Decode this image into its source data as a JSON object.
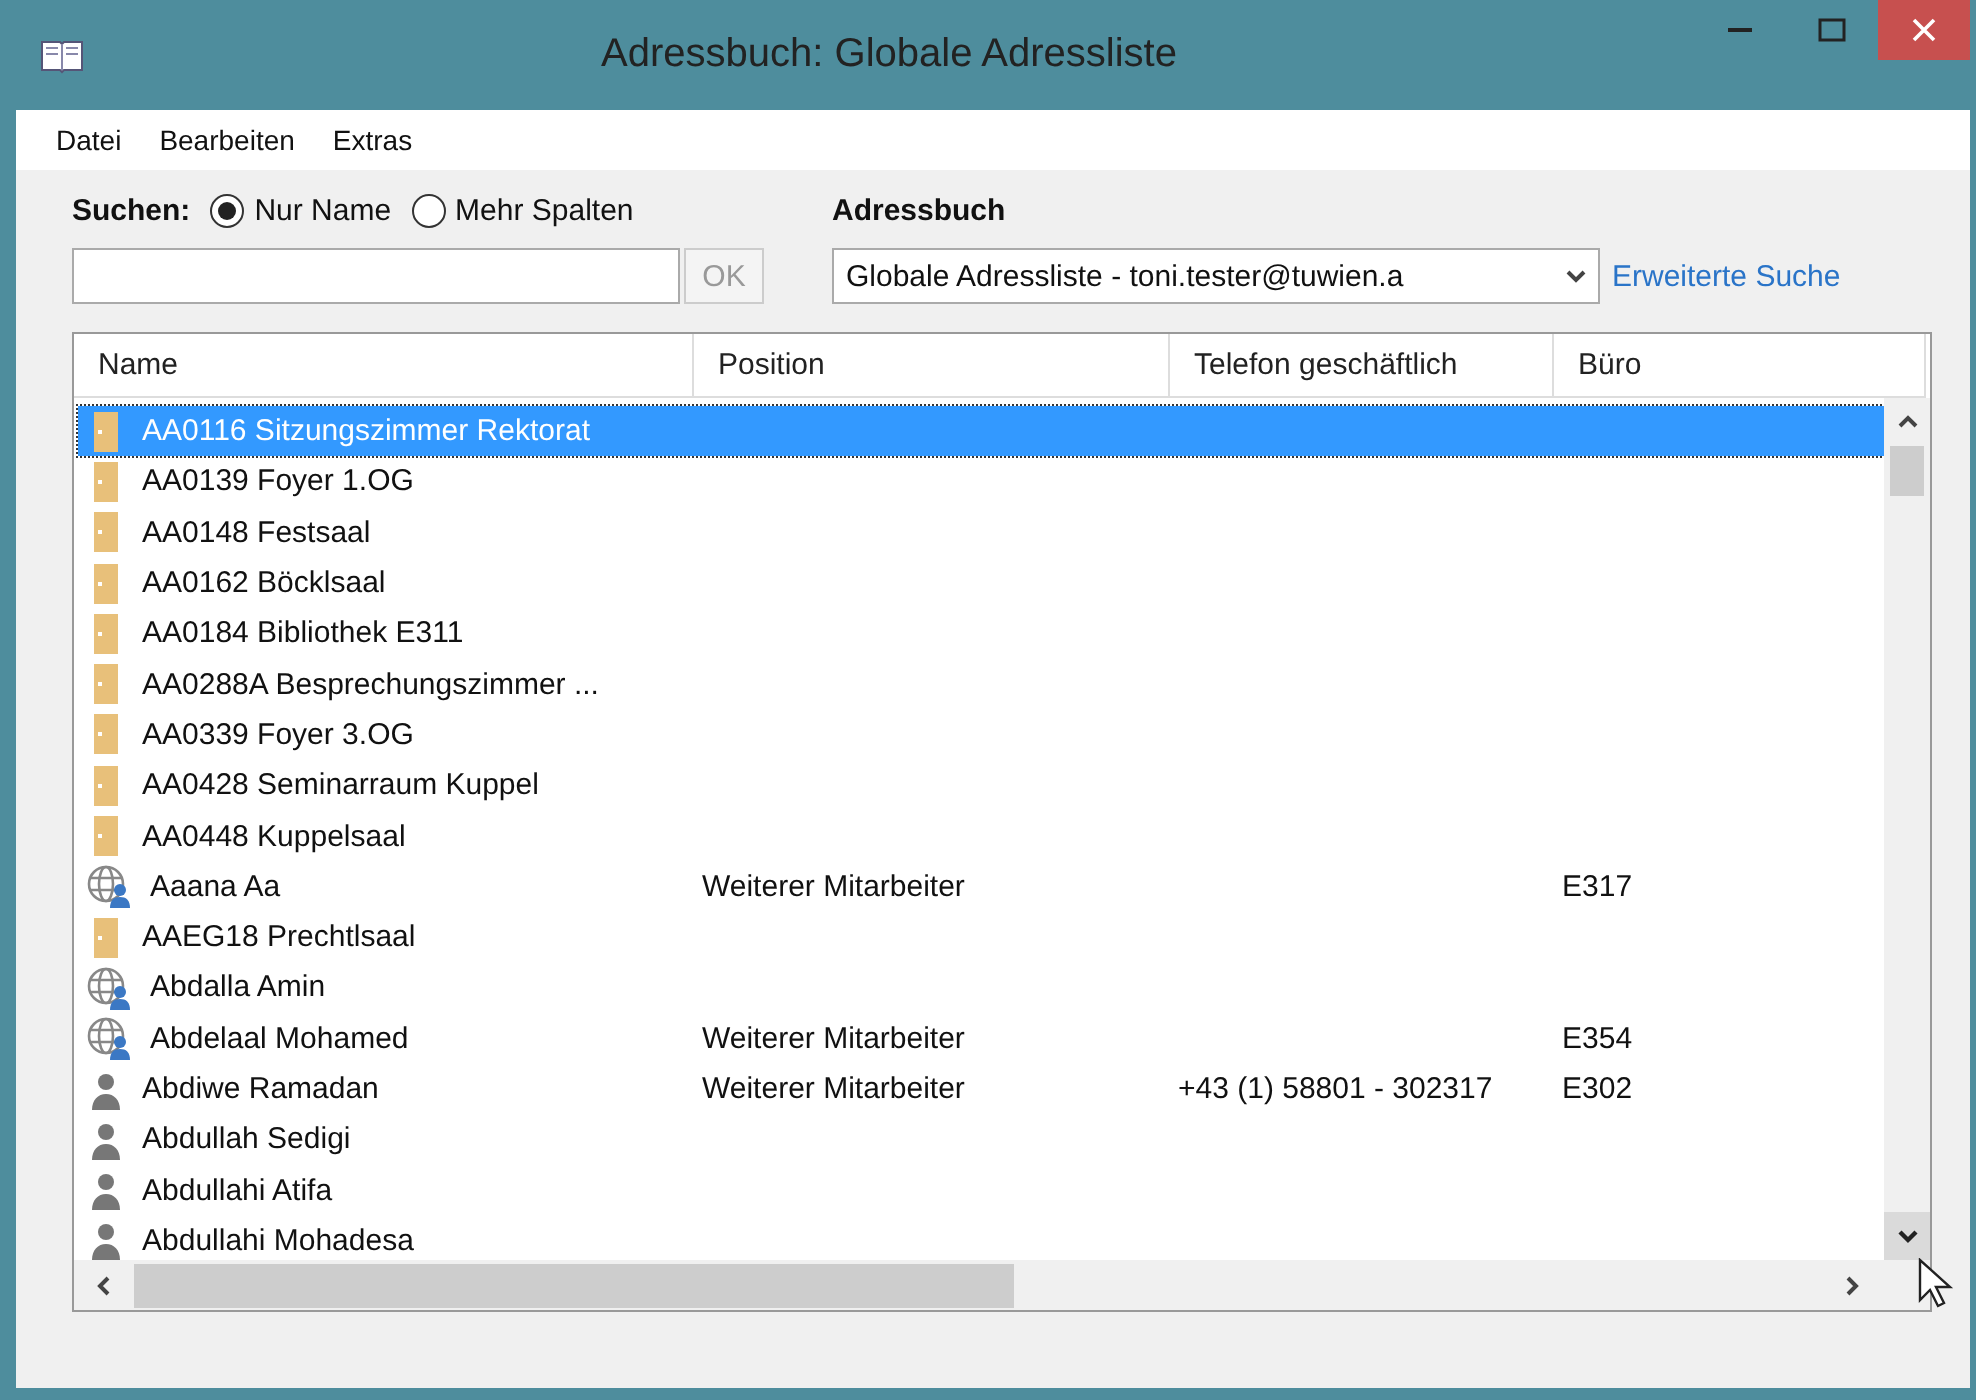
{
  "window": {
    "title": "Adressbuch: Globale Adressliste"
  },
  "menu": [
    "Datei",
    "Bearbeiten",
    "Extras"
  ],
  "search": {
    "label": "Suchen:",
    "options": [
      {
        "label": "Nur Name",
        "selected": true
      },
      {
        "label": "Mehr Spalten",
        "selected": false
      }
    ],
    "ok_button": "OK"
  },
  "address_book": {
    "label": "Adressbuch",
    "value": "Globale Adressliste - toni.tester@tuwien.a",
    "advanced_link": "Erweiterte Suche"
  },
  "table": {
    "columns": [
      "Name",
      "Position",
      "Telefon geschäftlich",
      "Büro"
    ],
    "rows": [
      {
        "kind": "room",
        "selected": true,
        "name": "AA0116 Sitzungszimmer Rektorat",
        "position": "",
        "phone": "",
        "office": ""
      },
      {
        "kind": "room",
        "selected": false,
        "name": "AA0139 Foyer 1.OG",
        "position": "",
        "phone": "",
        "office": ""
      },
      {
        "kind": "room",
        "selected": false,
        "name": "AA0148 Festsaal",
        "position": "",
        "phone": "",
        "office": ""
      },
      {
        "kind": "room",
        "selected": false,
        "name": "AA0162 Böcklsaal",
        "position": "",
        "phone": "",
        "office": ""
      },
      {
        "kind": "room",
        "selected": false,
        "name": "AA0184 Bibliothek E311",
        "position": "",
        "phone": "",
        "office": ""
      },
      {
        "kind": "room",
        "selected": false,
        "name": "AA0288A Besprechungszimmer ...",
        "position": "",
        "phone": "",
        "office": ""
      },
      {
        "kind": "room",
        "selected": false,
        "name": "AA0339 Foyer 3.OG",
        "position": "",
        "phone": "",
        "office": ""
      },
      {
        "kind": "room",
        "selected": false,
        "name": "AA0428 Seminarraum Kuppel",
        "position": "",
        "phone": "",
        "office": ""
      },
      {
        "kind": "room",
        "selected": false,
        "name": "AA0448 Kuppelsaal",
        "position": "",
        "phone": "",
        "office": ""
      },
      {
        "kind": "external",
        "selected": false,
        "name": "Aaana Aa",
        "position": "Weiterer Mitarbeiter",
        "phone": "",
        "office": "E317"
      },
      {
        "kind": "room",
        "selected": false,
        "name": "AAEG18 Prechtlsaal",
        "position": "",
        "phone": "",
        "office": ""
      },
      {
        "kind": "external",
        "selected": false,
        "name": "Abdalla Amin",
        "position": "",
        "phone": "",
        "office": ""
      },
      {
        "kind": "external",
        "selected": false,
        "name": "Abdelaal Mohamed",
        "position": "Weiterer Mitarbeiter",
        "phone": "",
        "office": "E354"
      },
      {
        "kind": "user",
        "selected": false,
        "name": "Abdiwe Ramadan",
        "position": "Weiterer Mitarbeiter",
        "phone": "+43 (1) 58801 - 302317",
        "office": "E302"
      },
      {
        "kind": "user",
        "selected": false,
        "name": "Abdullah Sedigi",
        "position": "",
        "phone": "",
        "office": ""
      },
      {
        "kind": "user",
        "selected": false,
        "name": "Abdullahi Atifa",
        "position": "",
        "phone": "",
        "office": ""
      },
      {
        "kind": "user",
        "selected": false,
        "name": "Abdullahi Mohadesa",
        "position": "",
        "phone": "",
        "office": ""
      }
    ]
  }
}
